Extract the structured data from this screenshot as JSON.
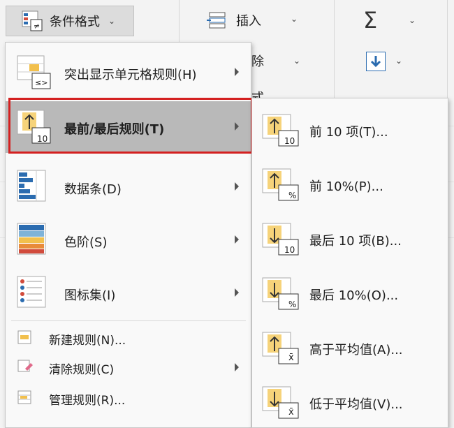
{
  "ribbon": {
    "conditional_format_label": "条件格式",
    "insert_label": "插入",
    "delete_fragment": "除",
    "format_fragment": "式",
    "sum_symbol": "Σ",
    "dropdown_glyph": "⌄"
  },
  "main_menu": {
    "items": [
      {
        "label": "突出显示单元格规则(H)",
        "icon": "highlight-cells-rules-icon",
        "icon_text": "≤>"
      },
      {
        "label": "最前/最后规则(T)",
        "icon": "top-bottom-rules-icon",
        "icon_text": "10"
      },
      {
        "label": "数据条(D)",
        "icon": "data-bars-icon"
      },
      {
        "label": "色阶(S)",
        "icon": "color-scales-icon"
      },
      {
        "label": "图标集(I)",
        "icon": "icon-sets-icon"
      },
      {
        "label": "新建规则(N)...",
        "icon": "new-rule-icon"
      },
      {
        "label": "清除规则(C)",
        "icon": "clear-rules-icon"
      },
      {
        "label": "管理规则(R)...",
        "icon": "manage-rules-icon"
      }
    ]
  },
  "sub_menu": {
    "items": [
      {
        "label": "前 10 项(T)...",
        "icon": "top-10-items-icon",
        "badge": "10",
        "arrow": "↑"
      },
      {
        "label": "前 10%(P)...",
        "icon": "top-10-percent-icon",
        "badge": "%",
        "arrow": "↑"
      },
      {
        "label": "最后 10 项(B)...",
        "icon": "bottom-10-items-icon",
        "badge": "10",
        "arrow": "↓"
      },
      {
        "label": "最后 10%(O)...",
        "icon": "bottom-10-percent-icon",
        "badge": "%",
        "arrow": "↓"
      },
      {
        "label": "高于平均值(A)...",
        "icon": "above-average-icon",
        "badge": "x̄",
        "arrow": "↑"
      },
      {
        "label": "低于平均值(V)...",
        "icon": "below-average-icon",
        "badge": "x̄",
        "arrow": "↓"
      }
    ]
  },
  "colors": {
    "selection_outline": "#d42020",
    "selected_bg": "#b9b9b9",
    "menu_bg": "#f9f9f9",
    "ribbon_bg": "#f3f3f3"
  }
}
